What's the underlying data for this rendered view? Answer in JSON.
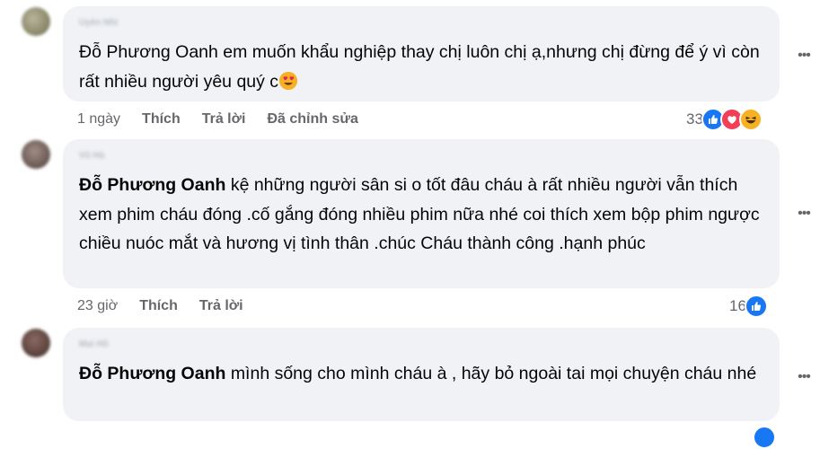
{
  "comments": [
    {
      "author": "Uyên Nhi",
      "mention": "",
      "text": "Đỗ Phương Oanh em muốn khẩu nghiệp thay chị luôn chị ạ,nhưng chị đừng để ý vì còn rất nhiều người yêu quý c",
      "time": "1 ngày",
      "like_label": "Thích",
      "reply_label": "Trả lời",
      "edited_label": "Đã chỉnh sửa",
      "reaction_count": "33",
      "reactions": [
        "like-icon",
        "love-icon",
        "haha-icon"
      ]
    },
    {
      "author": "Vũ Hà",
      "mention": "Đỗ Phương Oanh",
      "text": "kệ những người sân si o tốt đâu cháu à rất nhiều người vẫn thích xem phim cháu đóng .cố gắng đóng nhiều phim nữa nhé coi thích xem bộp phim ngược chiều nuóc mắt và hương vị tình thân .chúc Cháu thành công .hạnh phúc",
      "time": "23 giờ",
      "like_label": "Thích",
      "reply_label": "Trả lời",
      "reaction_count": "16",
      "reactions": [
        "like-icon"
      ]
    },
    {
      "author": "Mai Hồ",
      "mention": "Đỗ Phương Oanh",
      "text": "mình sống cho mình cháu à , hãy bỏ ngoài tai mọi chuyện cháu nhé"
    }
  ],
  "colors": {
    "bubble": "#f0f2f5",
    "meta_text": "#65676b",
    "like_blue": "#1877f2",
    "love_red": "#f33e58",
    "haha_yellow": "#f7b125"
  }
}
